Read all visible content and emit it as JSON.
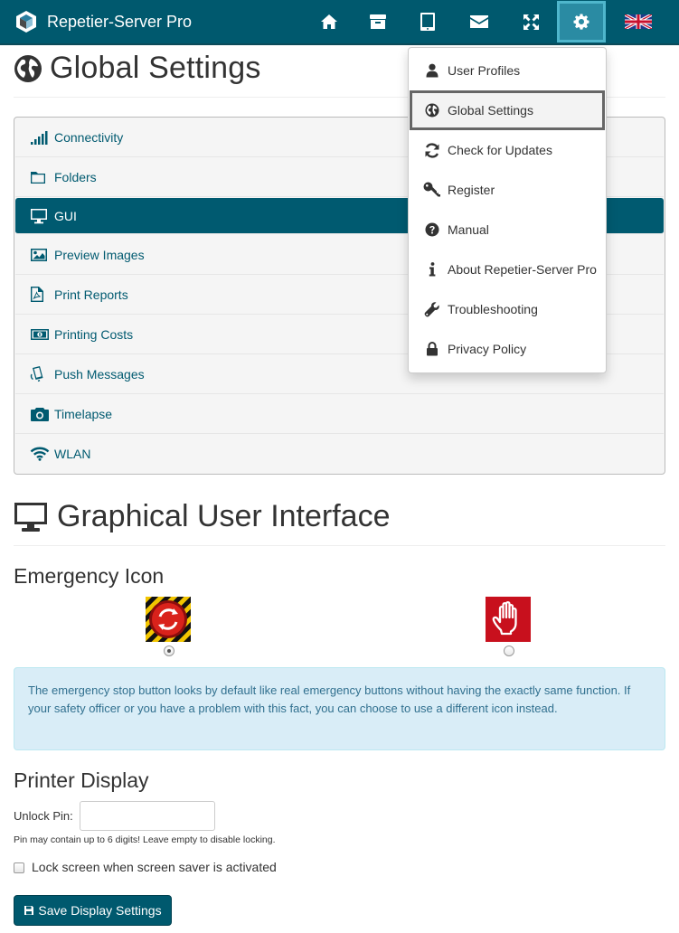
{
  "app": {
    "title": "Repetier-Server Pro"
  },
  "nav": {
    "icons": [
      "home-icon",
      "archive-icon",
      "tablet-icon",
      "envelope-icon",
      "expand-icon",
      "gear-icon",
      "uk-flag-icon"
    ],
    "active": "gear-icon"
  },
  "page": {
    "title": "Global Settings"
  },
  "settings_menu": [
    {
      "label": "Connectivity",
      "icon": "signal-icon"
    },
    {
      "label": "Folders",
      "icon": "folder-icon"
    },
    {
      "label": "GUI",
      "icon": "monitor-icon",
      "active": true
    },
    {
      "label": "Preview Images",
      "icon": "image-icon"
    },
    {
      "label": "Print Reports",
      "icon": "pdf-file-icon"
    },
    {
      "label": "Printing Costs",
      "icon": "money-icon"
    },
    {
      "label": "Push Messages",
      "icon": "mobile-icon"
    },
    {
      "label": "Timelapse",
      "icon": "camera-icon"
    },
    {
      "label": "WLAN",
      "icon": "wifi-icon"
    }
  ],
  "dropdown": [
    {
      "label": "User Profiles",
      "icon": "user-icon"
    },
    {
      "label": "Global Settings",
      "icon": "globe-icon",
      "active": true
    },
    {
      "label": "Check for Updates",
      "icon": "refresh-icon"
    },
    {
      "label": "Register",
      "icon": "key-icon"
    },
    {
      "label": "Manual",
      "icon": "question-icon"
    },
    {
      "label": "About Repetier-Server Pro",
      "icon": "info-icon"
    },
    {
      "label": "Troubleshooting",
      "icon": "wrench-icon"
    },
    {
      "label": "Privacy Policy",
      "icon": "lock-icon"
    }
  ],
  "gui": {
    "title": "Graphical User Interface",
    "emergency_title": "Emergency Icon",
    "emergency_selected": "classic",
    "info_text": "The emergency stop button looks by default like real emergency buttons without having the exactly same function. If your safety officer or you have a problem with this fact, you can choose to use a different icon instead.",
    "printer_display_title": "Printer Display",
    "unlock_pin_label": "Unlock Pin:",
    "unlock_pin_value": "",
    "pin_help": "Pin may contain up to 6 digits! Leave empty to disable locking.",
    "lock_screen_label": "Lock screen when screen saver is activated",
    "lock_screen_checked": false,
    "save_label": "Save Display Settings"
  },
  "colors": {
    "primary": "#00596e",
    "info_bg": "#d9edf7",
    "info_text": "#31708f"
  }
}
